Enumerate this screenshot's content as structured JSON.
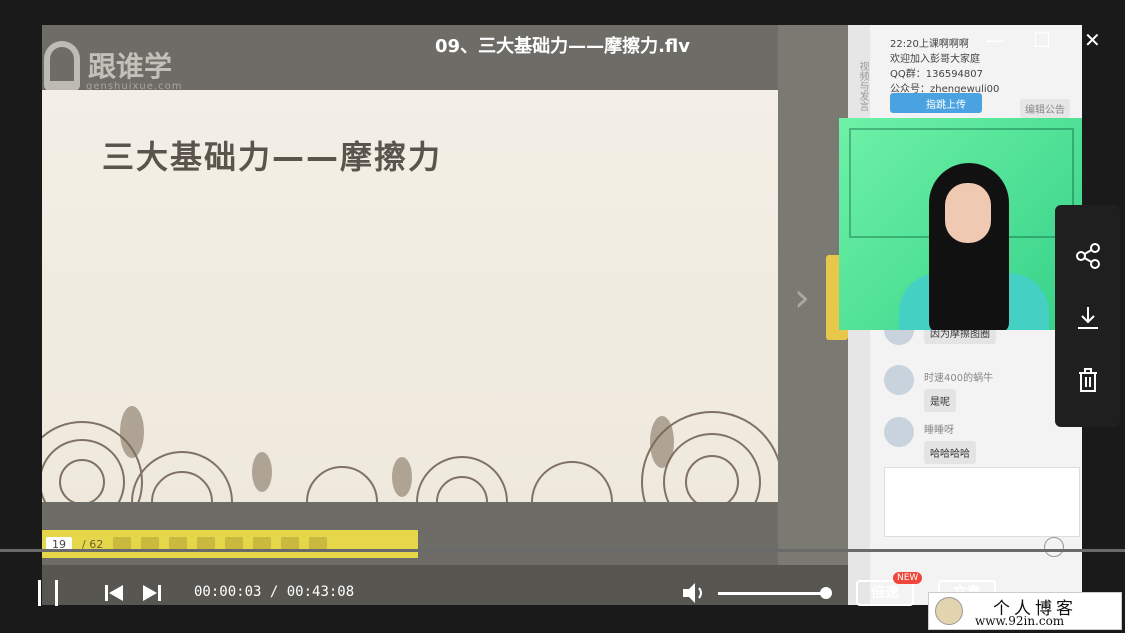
{
  "window": {
    "title": "09、三大基础力——摩擦力.flv",
    "minimize_glyph": "—",
    "maximize_glyph": "☐",
    "close_glyph": "✕"
  },
  "video": {
    "logo_name": "跟谁学",
    "logo_sub": "genshuixue.com",
    "slide_title": "三大基础力——摩擦力",
    "pen_toolbar": {
      "page_current": "19",
      "page_total": "/ 62"
    },
    "chat": {
      "side_tabs": "视频与发言",
      "announcement_lines": [
        "22:20上课啊啊啊",
        "欢迎加入彭哥大家庭",
        "QQ群：136594807",
        "公众号：zhengewuli00"
      ],
      "join_button": "指跳上传",
      "edit_announcement": "编辑公告",
      "messages": [
        {
          "name": "",
          "text": "因为摩擦图圈"
        },
        {
          "name": "时速400的蜗牛",
          "text": "是呢"
        },
        {
          "name": "睡睡呀",
          "text": "哈哈哈哈"
        }
      ]
    }
  },
  "player": {
    "current_time": "00:00:03",
    "separator": " / ",
    "total_time": "00:43:08",
    "progress": 0.001,
    "volume": 0.95,
    "speed_label": "倍速",
    "speed_badge": "NEW",
    "chat_label": "文章"
  },
  "side_panel": {
    "icons": [
      "share-icon",
      "download-icon",
      "trash-icon"
    ]
  },
  "watermark": {
    "title": "个人博客",
    "url": "www.92in.com"
  }
}
